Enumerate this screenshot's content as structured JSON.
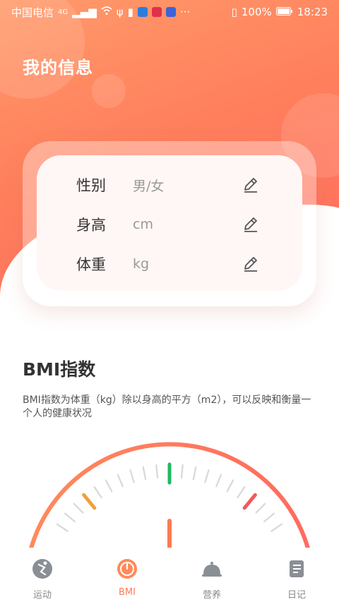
{
  "status_bar": {
    "carrier": "中国电信",
    "net": "4G",
    "dots": "···",
    "battery": "100%",
    "time": "18:23"
  },
  "header": {
    "title": "我的信息"
  },
  "info": [
    {
      "label": "性别",
      "value": "男/女"
    },
    {
      "label": "身高",
      "value": "cm"
    },
    {
      "label": "体重",
      "value": "kg"
    }
  ],
  "bmi": {
    "title": "BMI指数",
    "description": "BMI指数为体重（kg）除以身高的平方（m2），可以反映和衡量一个人的健康状况"
  },
  "tabs": [
    {
      "label": "运动",
      "icon": "exercise-icon",
      "active": false
    },
    {
      "label": "BMI",
      "icon": "bmi-gauge-icon",
      "active": true
    },
    {
      "label": "营养",
      "icon": "nutrition-icon",
      "active": false
    },
    {
      "label": "日记",
      "icon": "diary-icon",
      "active": false
    }
  ],
  "colors": {
    "accent": "#ff7a52",
    "gauge_low": "#f0a040",
    "gauge_normal": "#22b864",
    "gauge_high": "#f05a5a"
  }
}
